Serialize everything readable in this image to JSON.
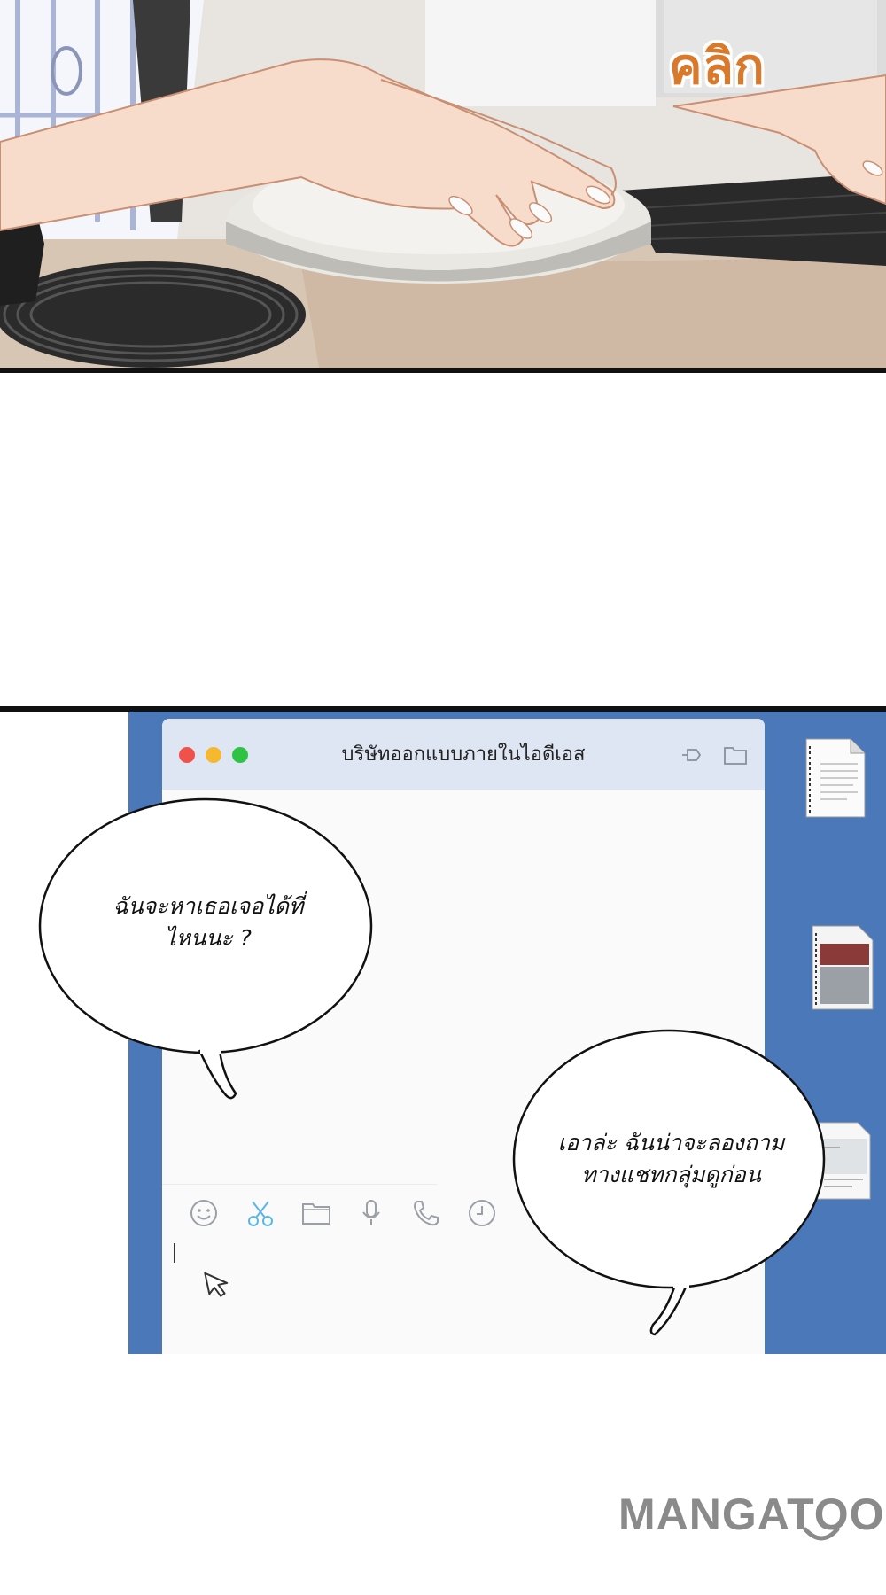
{
  "panel_top": {
    "sound_effect": "คลิก"
  },
  "chat_window": {
    "title": "บริษัทออกแบบภายในไอดีเอส",
    "window_controls": [
      "close",
      "minimize",
      "maximize"
    ],
    "title_icons": [
      "pin-icon",
      "folder-icon"
    ],
    "toolbar_icons": [
      "emoji-icon",
      "scissors-icon",
      "folder-icon",
      "microphone-icon",
      "phone-icon",
      "clock-icon"
    ],
    "accent_color": "#5bb6e6"
  },
  "bubbles": {
    "left_line1": "ฉันจะหาเธอเจอได้ที่",
    "left_line2": "ไหนนะ ?",
    "right_line1": "เอาล่ะ ฉันน่าจะลองถาม",
    "right_line2": "ทางแชทกลุ่มดูก่อน"
  },
  "desktop": {
    "background_color": "#4a78b8",
    "icons": [
      "document-icon",
      "document-icon",
      "document-icon"
    ]
  },
  "watermark": "MANGATOON"
}
